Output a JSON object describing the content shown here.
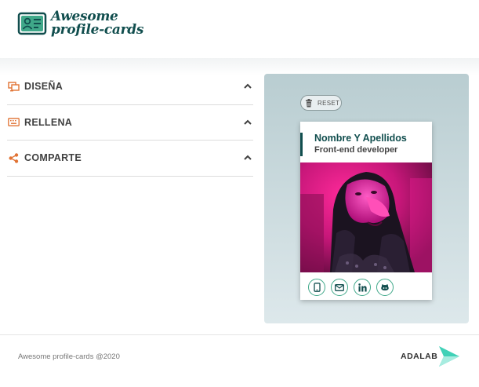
{
  "header": {
    "logo_line1": "Awesome",
    "logo_line2": "profile-cards",
    "logo_icon": "id-card-icon"
  },
  "accordion": [
    {
      "label": "DISEÑA",
      "icon": "palette-icon"
    },
    {
      "label": "RELLENA",
      "icon": "keyboard-icon"
    },
    {
      "label": "COMPARTE",
      "icon": "share-icon"
    }
  ],
  "preview": {
    "reset_label": "RESET",
    "card": {
      "name": "Nombre Y Apellidos",
      "job": "Front-end developer",
      "icons": [
        "phone-icon",
        "email-icon",
        "linkedin-icon",
        "github-icon"
      ]
    }
  },
  "footer": {
    "copyright": "Awesome profile-cards @2020",
    "brand": "ADALAB"
  },
  "colors": {
    "brand_dark": "#114e4e",
    "accent_orange": "#e17334",
    "card_green": "#3fa889"
  }
}
